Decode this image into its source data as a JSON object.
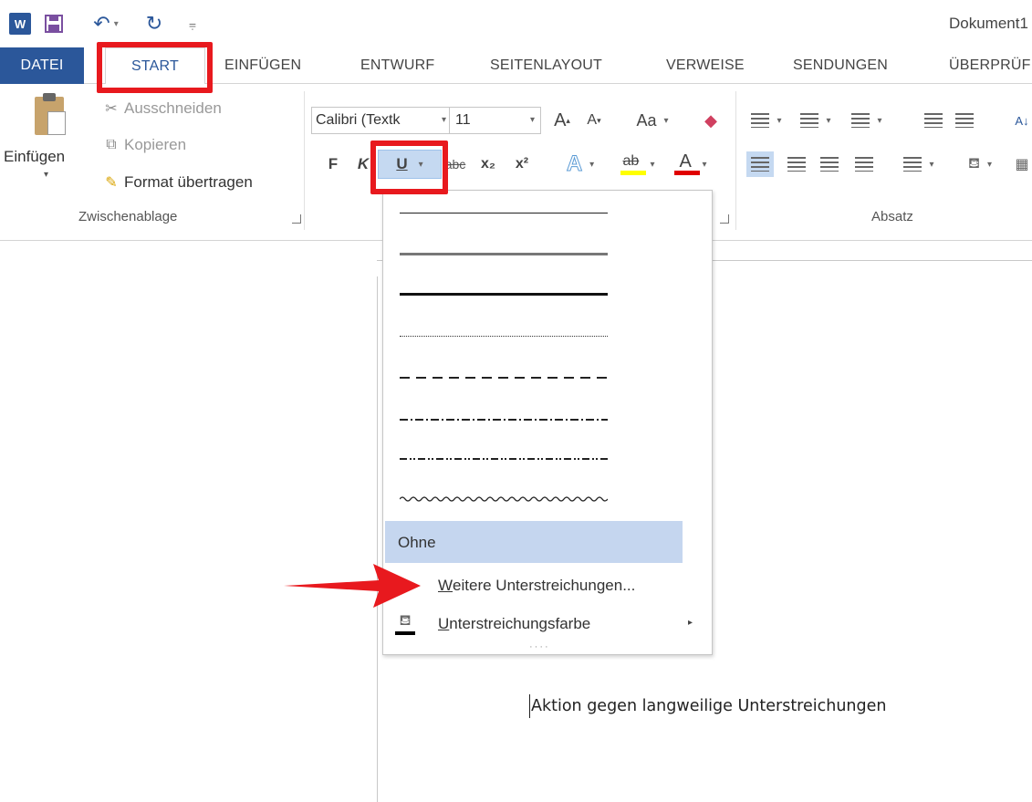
{
  "title_bar": {
    "app_icon_text": "W",
    "qa_more": "⩦",
    "document_title": "Dokument1"
  },
  "tabs": {
    "datei": "DATEI",
    "start": "START",
    "einfuegen": "EINFÜGEN",
    "entwurf": "ENTWURF",
    "seitenlayout": "SEITENLAYOUT",
    "verweise": "VERWEISE",
    "sendungen": "SENDUNGEN",
    "ueberpruefen": "ÜBERPRÜF"
  },
  "clipboard": {
    "paste": "Einfügen",
    "cut": "Ausschneiden",
    "copy": "Kopieren",
    "format_painter": "Format übertragen",
    "group_label": "Zwischenablage"
  },
  "font": {
    "name": "Calibri (Textk",
    "size": "11",
    "grow": "A",
    "shrink": "A",
    "change_case": "Aa",
    "bold": "F",
    "italic": "K",
    "underline": "U",
    "strikethrough": "abc",
    "subscript": "x₂",
    "superscript": "x²",
    "text_effects": "A",
    "highlight": "ab",
    "font_color": "A",
    "highlight_color": "#ffff00",
    "font_color_value": "#e00000"
  },
  "paragraph": {
    "group_label": "Absatz",
    "sort": "A↓"
  },
  "underline_menu": {
    "ohne": "Ohne",
    "weitere_accel": "W",
    "weitere_rest": "eitere Unterstreichungen...",
    "farbe_accel": "U",
    "farbe_rest": "nterstreichungsfarbe",
    "grip": "····"
  },
  "document": {
    "text": "Aktion gegen langweilige Unterstreichungen"
  },
  "annotations": {
    "highlight_color": "#e8191e"
  }
}
